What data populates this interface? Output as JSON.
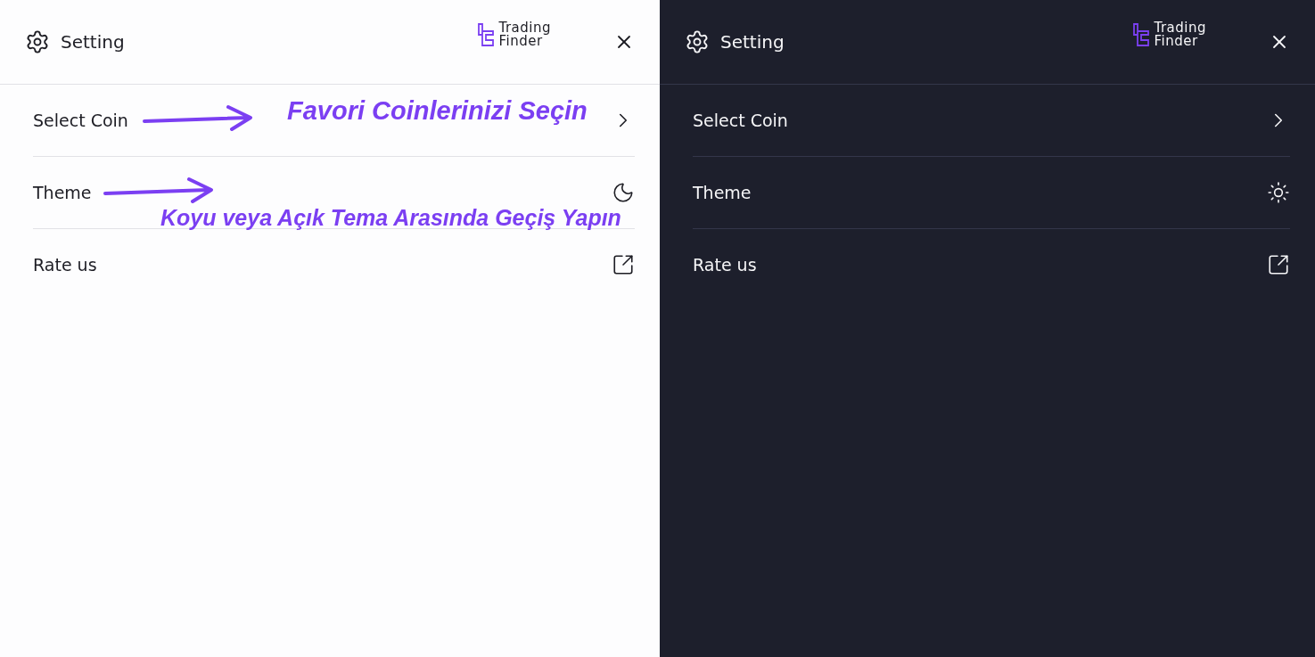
{
  "panels": [
    {
      "kind": "light",
      "title": "Setting",
      "logo": [
        "Trading",
        "Finder"
      ],
      "items": [
        {
          "label": "Select Coin",
          "kind": "chevron",
          "annotation": "Favori Coinlerinizi Seçin"
        },
        {
          "label": "Theme",
          "kind": "moon",
          "annotation": "Koyu veya Açık Tema Arasında Geçiş Yapın"
        },
        {
          "label": "Rate us",
          "kind": "external"
        }
      ]
    },
    {
      "kind": "dark",
      "title": "Setting",
      "logo": [
        "Trading",
        "Finder"
      ],
      "items": [
        {
          "label": "Select Coin",
          "kind": "chevron"
        },
        {
          "label": "Theme",
          "kind": "sun"
        },
        {
          "label": "Rate us",
          "kind": "external"
        }
      ]
    }
  ]
}
